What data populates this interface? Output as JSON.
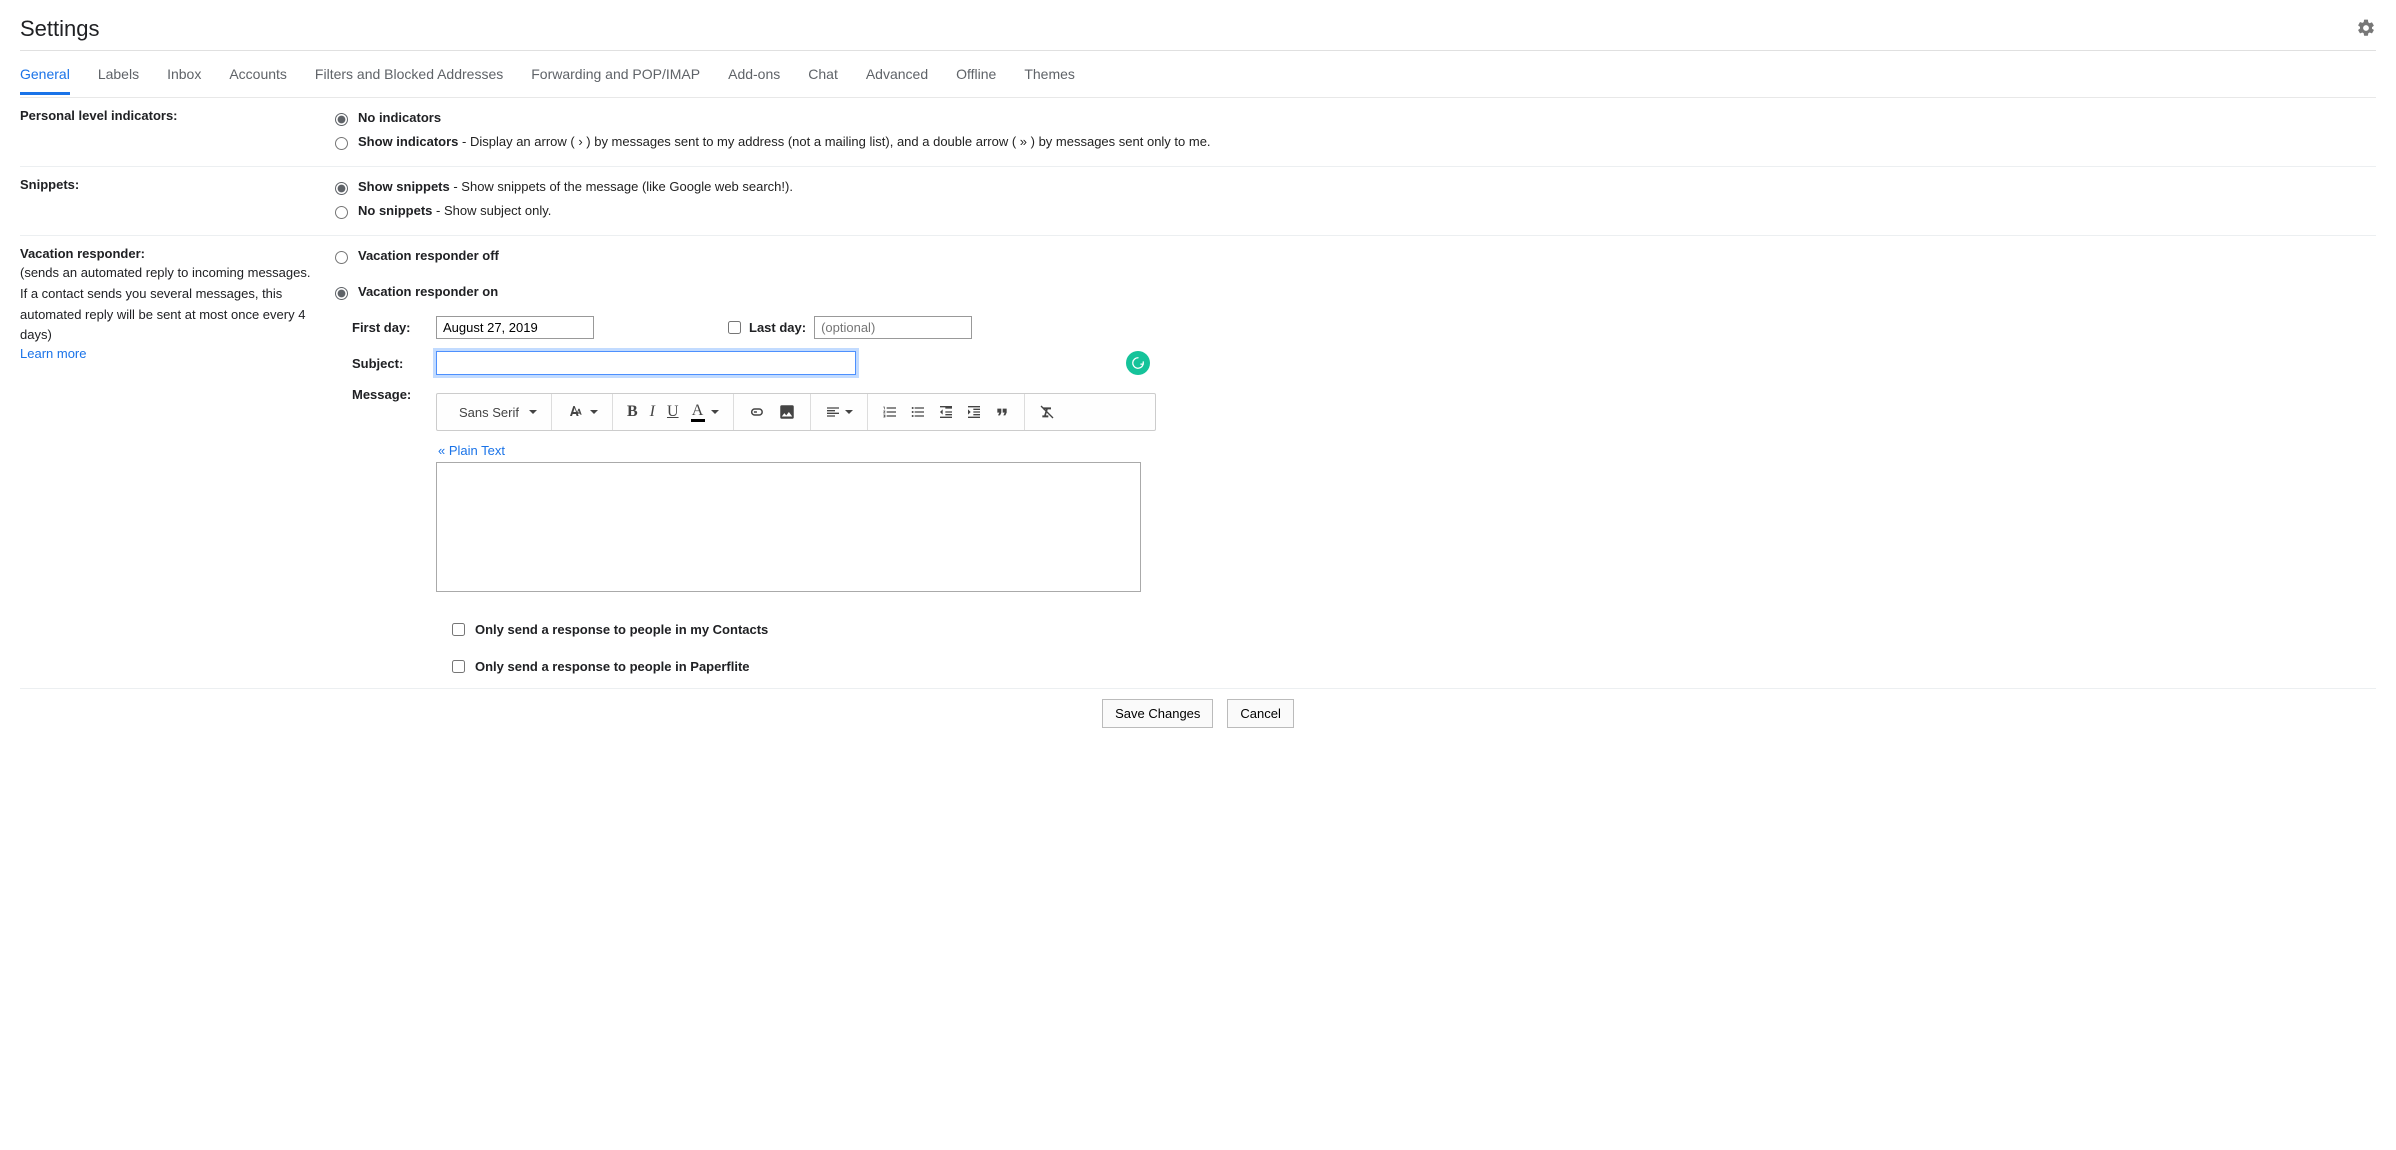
{
  "header": {
    "title": "Settings"
  },
  "tabs": [
    "General",
    "Labels",
    "Inbox",
    "Accounts",
    "Filters and Blocked Addresses",
    "Forwarding and POP/IMAP",
    "Add-ons",
    "Chat",
    "Advanced",
    "Offline",
    "Themes"
  ],
  "personal_indicators": {
    "label": "Personal level indicators:",
    "opt1_bold": "No indicators",
    "opt2_bold": "Show indicators",
    "opt2_desc": " - Display an arrow ( › ) by messages sent to my address (not a mailing list), and a double arrow ( » ) by messages sent only to me."
  },
  "snippets": {
    "label": "Snippets:",
    "opt1_bold": "Show snippets",
    "opt1_desc": " - Show snippets of the message (like Google web search!).",
    "opt2_bold": "No snippets",
    "opt2_desc": " - Show subject only."
  },
  "vacation": {
    "label": "Vacation responder:",
    "desc": "(sends an automated reply to incoming messages. If a contact sends you several messages, this automated reply will be sent at most once every 4 days)",
    "learn_more": "Learn more",
    "opt_off": "Vacation responder off",
    "opt_on": "Vacation responder on",
    "first_day_label": "First day:",
    "first_day_value": "August 27, 2019",
    "last_day_label": "Last day:",
    "last_day_placeholder": "(optional)",
    "subject_label": "Subject:",
    "subject_value": "",
    "message_label": "Message:",
    "font_name": "Sans Serif",
    "plain_text": "« Plain Text",
    "check_contacts": "Only send a response to people in my Contacts",
    "check_org": "Only send a response to people in Paperflite"
  },
  "footer": {
    "save": "Save Changes",
    "cancel": "Cancel"
  }
}
